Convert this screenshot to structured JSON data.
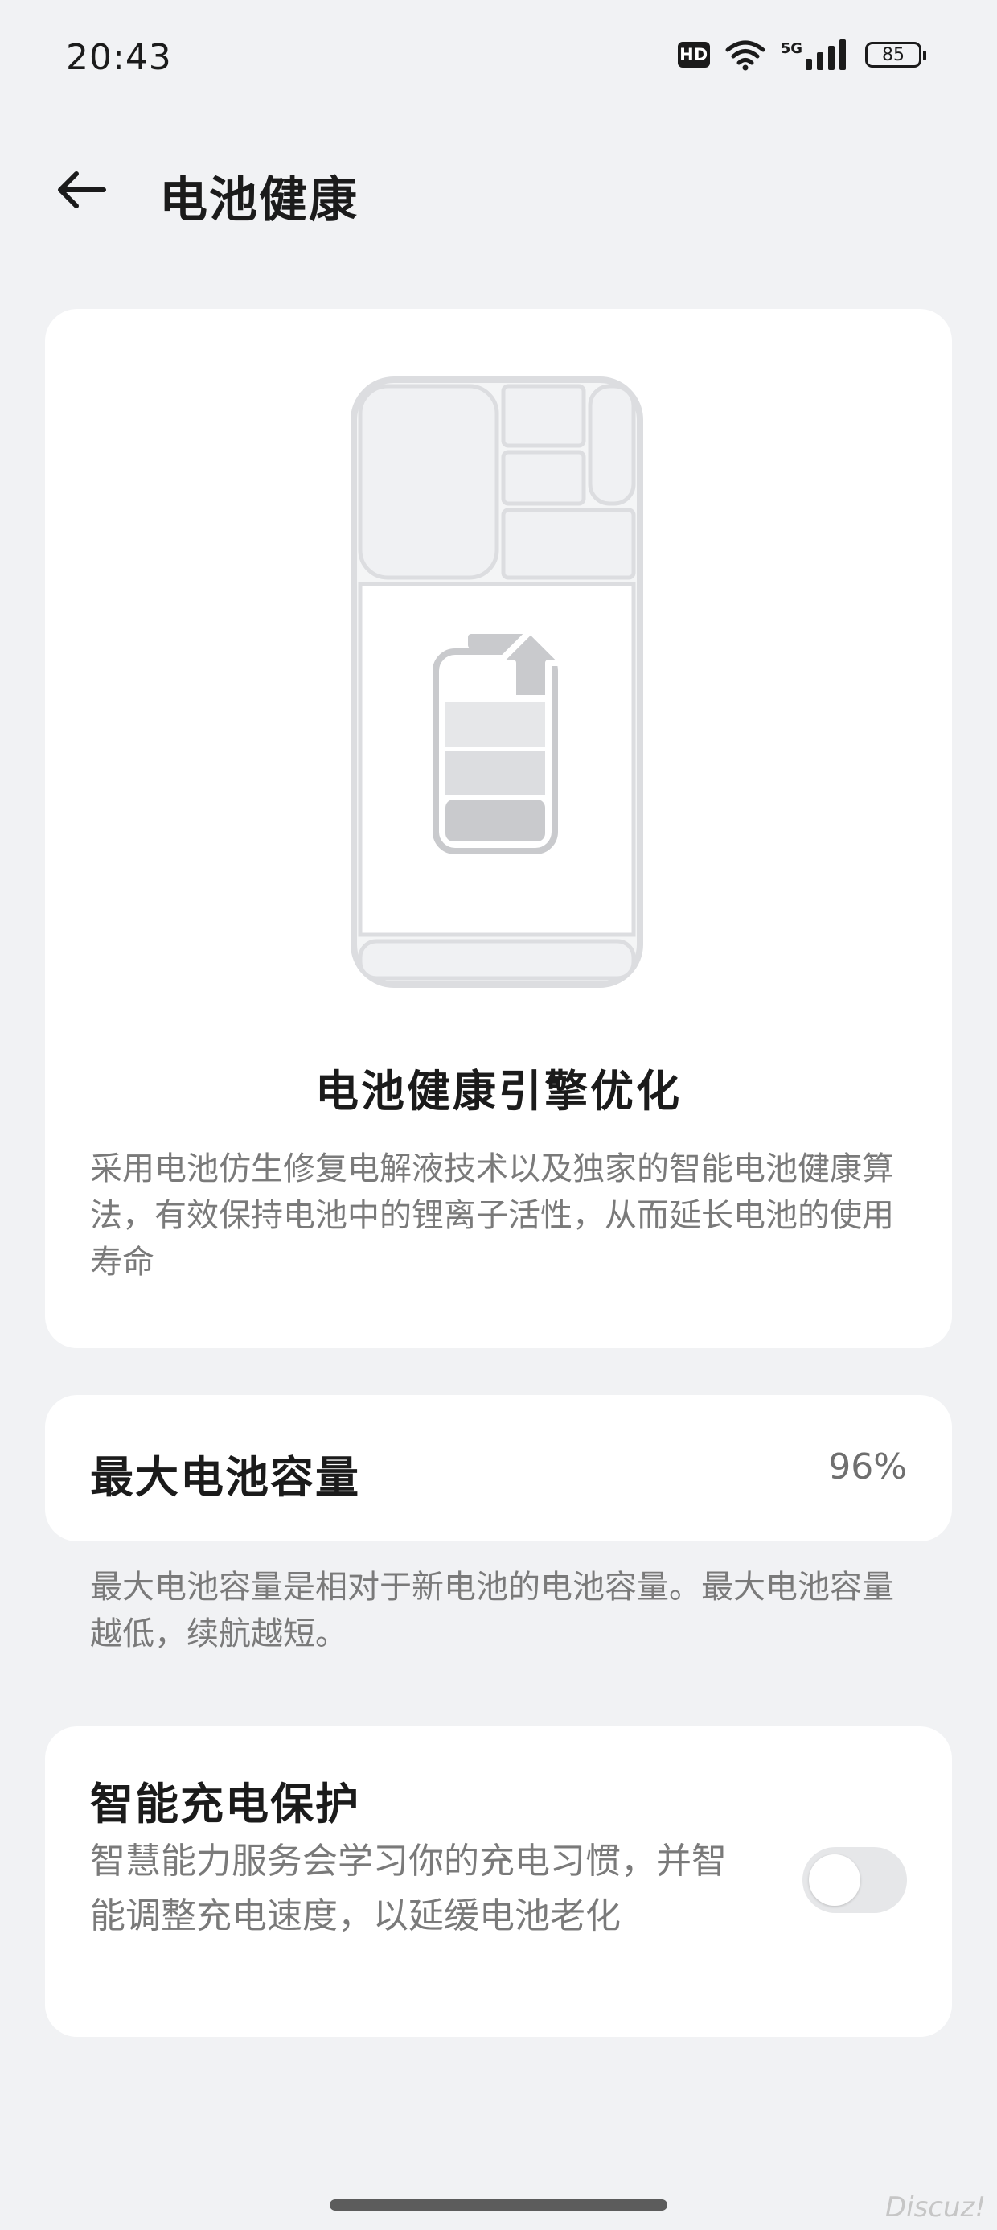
{
  "status_bar": {
    "time": "20:43",
    "hd_label": "HD",
    "network_label": "5G",
    "battery_level": "85",
    "icons": [
      "hd-icon",
      "wifi-icon",
      "cellular-5g-icon",
      "battery-icon"
    ]
  },
  "header": {
    "back_icon": "arrow-left-icon",
    "title": "电池健康"
  },
  "hero_card": {
    "illustration": "battery-charging-phone-illustration",
    "title": "电池健康引擎优化",
    "description": "采用电池仿生修复电解液技术以及独家的智能电池健康算法，有效保持电池中的锂离子活性，从而延长电池的使用寿命"
  },
  "capacity": {
    "label": "最大电池容量",
    "value": "96%",
    "note": "最大电池容量是相对于新电池的电池容量。最大电池容量越低，续航越短。"
  },
  "smart_charging": {
    "title": "智能充电保护",
    "description": "智慧能力服务会学习你的充电习惯，并智能调整充电速度，以延缓电池老化",
    "enabled": false
  },
  "watermark": "Discuz!",
  "colors": {
    "background": "#f1f2f4",
    "card": "#ffffff",
    "secondary_text": "#7a7a7a",
    "toggle_off": "#e6e7e9"
  }
}
